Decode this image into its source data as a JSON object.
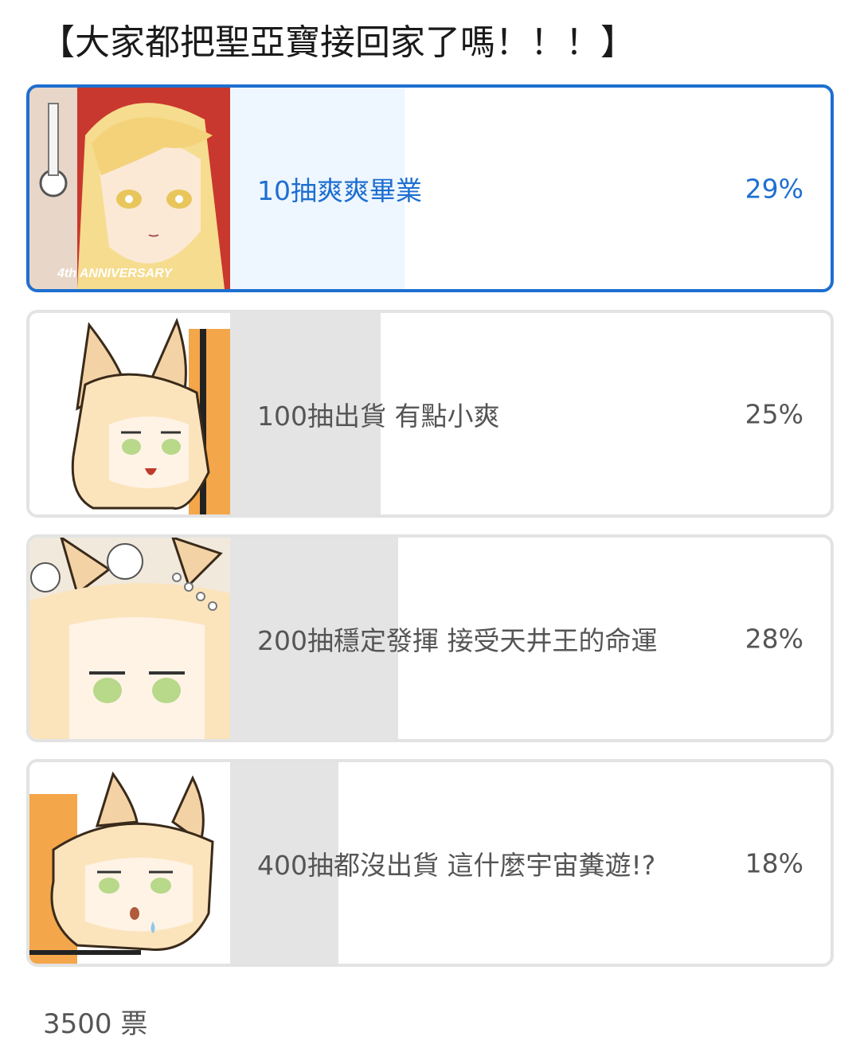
{
  "poll": {
    "title": "【大家都把聖亞寶接回家了嗎！！！】",
    "options": [
      {
        "label": "10抽爽爽畢業",
        "percent_text": "29%",
        "percent": 29,
        "selected": true,
        "thumbnail": "character-portrait-4th-anniversary",
        "thumbnail_text": "4th ANNIVERSARY"
      },
      {
        "label": "100抽出貨 有點小爽",
        "percent_text": "25%",
        "percent": 25,
        "selected": false,
        "thumbnail": "character-sticker-open-mouth"
      },
      {
        "label": "200抽穩定發揮 接受天井王的命運",
        "percent_text": "28%",
        "percent": 28,
        "selected": false,
        "thumbnail": "character-sticker-flower-crown"
      },
      {
        "label": "400抽都沒出貨 這什麼宇宙糞遊!?",
        "percent_text": "18%",
        "percent": 18,
        "selected": false,
        "thumbnail": "character-sticker-sweat"
      }
    ],
    "vote_count": "3500 票"
  },
  "colors": {
    "accent": "#1e6fd0",
    "selected_fill": "#eef6ff",
    "bar_fill": "#e4e4e4",
    "border": "#e3e3e3",
    "text": "#555555"
  }
}
